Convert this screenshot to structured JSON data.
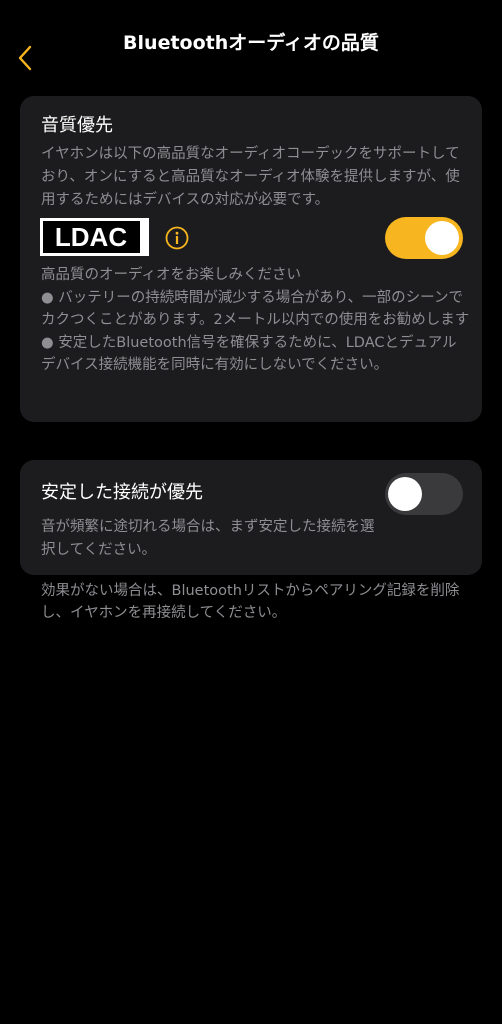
{
  "header": {
    "title": "Bluetoothオーディオの品質",
    "back_icon": "chevron-left-icon",
    "accent_color": "#f7b51f"
  },
  "sound_quality": {
    "title": "音質優先",
    "description": "イヤホンは以下の高品質なオーディオコーデックをサポートしており、オンにすると高品質なオーディオ体験を提供しますが、使用するためにはデバイスの対応が必要です。",
    "ldac_logo_text": "LDAC",
    "info_icon": "info-icon",
    "toggle_state": "on",
    "enjoy_text": "高品質のオーディオをお楽しみください",
    "bullet1": "● バッテリーの持続時間が減少する場合があり、一部のシーンでカクつくことがあります。2メートル以内での使用をお勧めします",
    "bullet2": "● 安定したBluetooth信号を確保するために、LDACとデュアルデバイス接続機能を同時に有効にしないでください。"
  },
  "stable_connection": {
    "title": "安定した接続が優先",
    "description": "音が頻繁に途切れる場合は、まず安定した接続を選択してください。",
    "toggle_state": "off"
  },
  "footer_note": "効果がない場合は、Bluetoothリストからペアリング記録を削除し、イヤホンを再接続してください。"
}
